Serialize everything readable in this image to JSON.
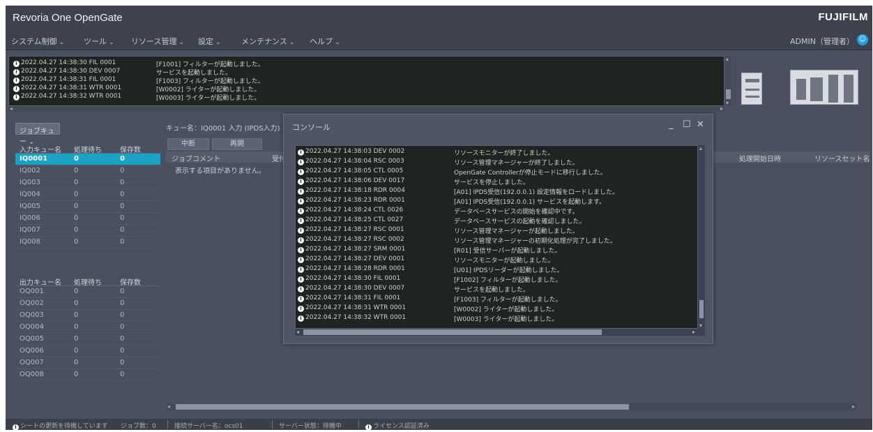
{
  "app": {
    "title": "Revoria One OpenGate",
    "brand": "FUJIFILM"
  },
  "menu": [
    {
      "label": "システム制御"
    },
    {
      "label": "ツール"
    },
    {
      "label": "リソース管理"
    },
    {
      "label": "設定"
    },
    {
      "label": "メンテナンス"
    },
    {
      "label": "ヘルプ"
    }
  ],
  "user": {
    "label": "ADMIN（管理者）"
  },
  "log": {
    "rows": [
      {
        "time": "2022.04.27 14:38:30 FIL 0001",
        "msg": "[F1001] フィルターが起動しました。"
      },
      {
        "time": "2022.04.27 14:38:30 DEV 0007",
        "msg": "サービスを起動しました。"
      },
      {
        "time": "2022.04.27 14:38:31 FIL 0001",
        "msg": "[F1003] フィルターが起動しました。"
      },
      {
        "time": "2022.04.27 14:38:31 WTR 0001",
        "msg": "[W0002] ライターが起動しました。"
      },
      {
        "time": "2022.04.27 14:38:32 WTR 0001",
        "msg": "[W0003] ライターが起動しました。"
      }
    ]
  },
  "left": {
    "queue_button": "ジョブキュー",
    "table1": {
      "headers": [
        "入力キュー名",
        "処理待ち",
        "保存数"
      ],
      "rows": [
        [
          "IQ0001",
          "0",
          "0"
        ],
        [
          "IQ002",
          "0",
          "0"
        ],
        [
          "IQ003",
          "0",
          "0"
        ],
        [
          "IQ004",
          "0",
          "0"
        ],
        [
          "IQ005",
          "0",
          "0"
        ],
        [
          "IQ006",
          "0",
          "0"
        ],
        [
          "IQ007",
          "0",
          "0"
        ],
        [
          "IQ008",
          "0",
          "0"
        ]
      ]
    },
    "table2": {
      "headers": [
        "出力キュー名",
        "処理待ち",
        "保存数"
      ],
      "rows": [
        [
          "OQ001",
          "0",
          "0"
        ],
        [
          "OQ002",
          "0",
          "0"
        ],
        [
          "OQ003",
          "0",
          "0"
        ],
        [
          "OQ004",
          "0",
          "0"
        ],
        [
          "OQ005",
          "0",
          "0"
        ],
        [
          "OQ006",
          "0",
          "0"
        ],
        [
          "OQ007",
          "0",
          "0"
        ],
        [
          "OQ008",
          "0",
          "0"
        ]
      ]
    }
  },
  "queue": {
    "info": "キュー名：IQ0001 入力 (IPDS入力)",
    "buttons": [
      "中断",
      "再開"
    ],
    "headers": [
      "ジョブコメント",
      "受付",
      "処理開始日時",
      "リソースセット名"
    ],
    "empty_text": "表示する項目がありません。"
  },
  "status": {
    "segments": [
      "シートの更新を待機しています",
      "ジョブ数：0",
      "接続サーバー名：ocs01",
      "サーバー状態：待機中",
      "ライセンス認証済み"
    ]
  },
  "console": {
    "title": "コンソール",
    "rows": [
      {
        "time": "2022.04.27 14:38:03 DEV 0002",
        "msg": "リソースモニターが終了しました。"
      },
      {
        "time": "2022.04.27 14:38:04 RSC 0003",
        "msg": "リソース管理マネージャーが終了しました。"
      },
      {
        "time": "2022.04.27 14:38:05 CTL 0005",
        "msg": "OpenGate Controllerが停止モードに移行しました。"
      },
      {
        "time": "2022.04.27 14:38:06 DEV 0017",
        "msg": "サービスを停止しました。"
      },
      {
        "time": "2022.04.27 14:38:18 RDR 0004",
        "msg": "[A01] IPDS受信(192.0.0.1) 設定情報をロードしました。"
      },
      {
        "time": "2022.04.27 14:38:23 RDR 0001",
        "msg": "[A01] IPDS受信(192.0.0.1) サービスを起動します。"
      },
      {
        "time": "2022.04.27 14:38:24 CTL 0026",
        "msg": "データベースサービスの開始を確認中です。"
      },
      {
        "time": "2022.04.27 14:38:25 CTL 0027",
        "msg": "データベースサービスの起動を確認しました。"
      },
      {
        "time": "2022.04.27 14:38:27 RSC 0001",
        "msg": "リソース管理マネージャーが起動しました。"
      },
      {
        "time": "2022.04.27 14:38:27 RSC 0002",
        "msg": "リソース管理マネージャーの初期化処理が完了しました。"
      },
      {
        "time": "2022.04.27 14:38:27 SRM 0001",
        "msg": "[R01] 受信サーバーが起動しました。"
      },
      {
        "time": "2022.04.27 14:38:27 DEV 0001",
        "msg": "リソースモニターが起動しました。"
      },
      {
        "time": "2022.04.27 14:38:28 RDR 0001",
        "msg": "[U01] IPDSリーダーが起動しました。"
      },
      {
        "time": "2022.04.27 14:38:30 FIL 0001",
        "msg": "[F1002] フィルターが起動しました。"
      },
      {
        "time": "2022.04.27 14:38:30 DEV 0007",
        "msg": "サービスを起動しました。"
      },
      {
        "time": "2022.04.27 14:38:31 FIL 0001",
        "msg": "[F1003] フィルターが起動しました。"
      },
      {
        "time": "2022.04.27 14:38:31 WTR 0001",
        "msg": "[W0002] ライターが起動しました。"
      },
      {
        "time": "2022.04.27 14:38:32 WTR 0001",
        "msg": "[W0003] ライターが起動しました。"
      }
    ]
  },
  "icons": [
    "info-icon",
    "user-icon",
    "minimize-icon",
    "maximize-icon",
    "close-icon",
    "chevron-down-icon",
    "printer-icon",
    "production-printer-icon"
  ],
  "colors": {
    "accent": "#1aa3c4",
    "background": "#4a5060",
    "log_background": "#1e2420"
  }
}
